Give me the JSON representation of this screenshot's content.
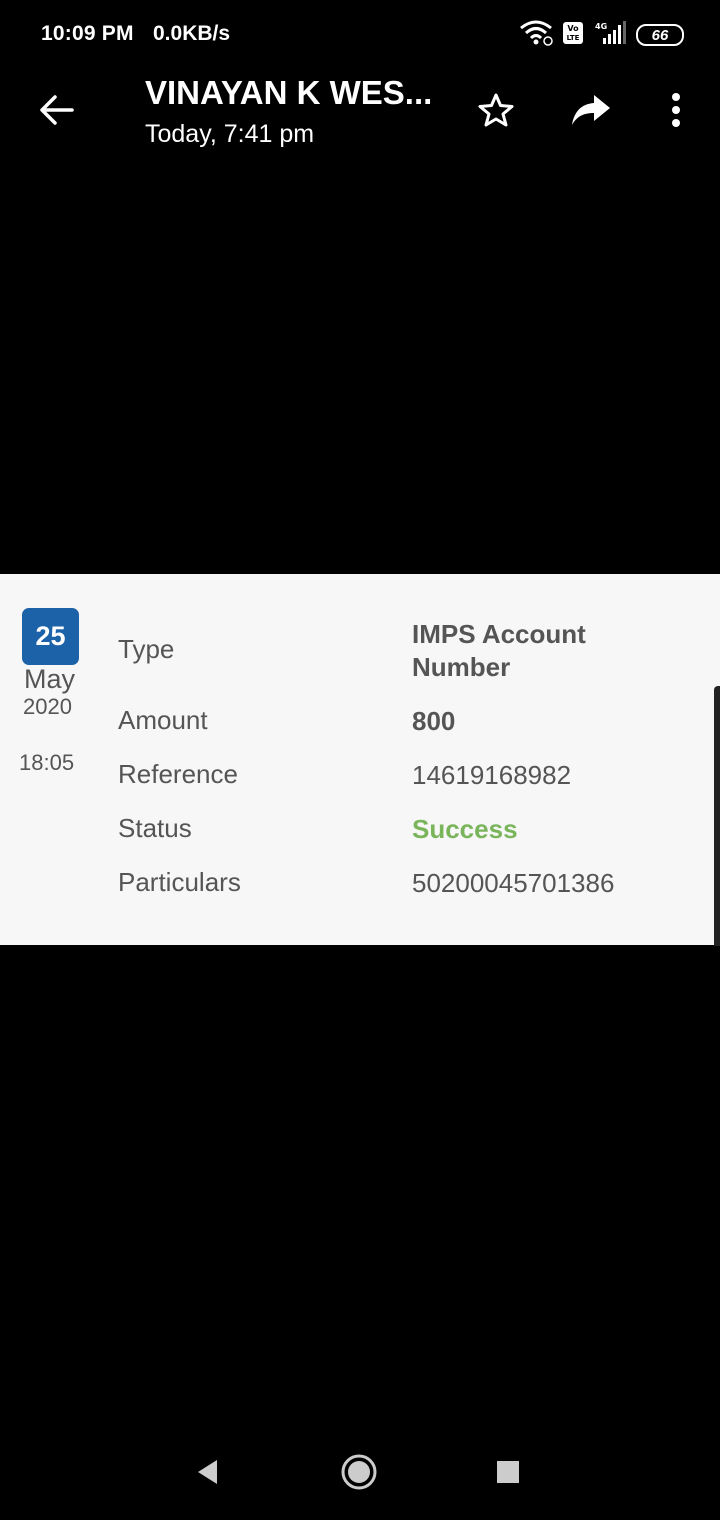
{
  "status_bar": {
    "time": "10:09 PM",
    "speed": "0.0KB/s",
    "network": "4G",
    "volte": "Vo LTE",
    "battery": "66"
  },
  "app_bar": {
    "title": "VINAYAN K WES...",
    "subtitle": "Today, 7:41 pm",
    "icons": [
      "back-arrow-icon",
      "star-icon",
      "share-icon",
      "more-vert-icon"
    ]
  },
  "transaction": {
    "date": {
      "day": "25",
      "month": "May",
      "year": "2020",
      "time": "18:05"
    },
    "rows": [
      {
        "label": "Type",
        "value": "IMPS Account Number"
      },
      {
        "label": "Amount",
        "value": "800"
      },
      {
        "label": "Reference",
        "value": "14619168982"
      },
      {
        "label": "Status",
        "value": "Success"
      },
      {
        "label": "Particulars",
        "value": "50200045701386"
      }
    ],
    "badge_color": "#1b62a8",
    "success_color": "#7ab55c"
  },
  "nav_bar": {
    "icons": [
      "back-triangle-icon",
      "home-circle-icon",
      "recents-square-icon"
    ]
  }
}
